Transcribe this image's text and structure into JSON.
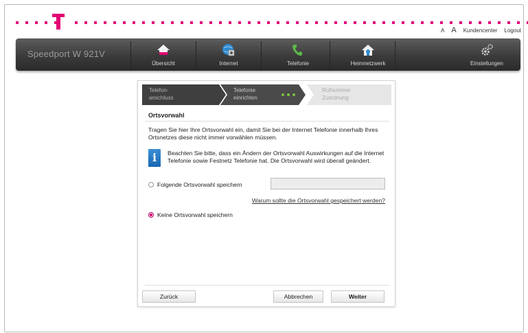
{
  "header": {
    "font_small_label": "A",
    "font_large_label": "A",
    "kundencenter_label": "Kundencenter",
    "logout_label": "Logout",
    "brand_color": "#e20074"
  },
  "navbar": {
    "title": "Speedport W 921V",
    "items": [
      {
        "label": "Übersicht",
        "icon": "home-icon"
      },
      {
        "label": "Internet",
        "icon": "globe-icon"
      },
      {
        "label": "Telefonie",
        "icon": "phone-icon"
      },
      {
        "label": "Heimnetzwerk",
        "icon": "home-network-icon"
      },
      {
        "label": "Einstellungen",
        "icon": "gears-icon"
      }
    ]
  },
  "wizard": {
    "steps": [
      {
        "line1": "Telefon-",
        "line2": "anschluss",
        "state": "done"
      },
      {
        "line1": "Telefonie",
        "line2": "einrichten",
        "state": "active"
      },
      {
        "line1": "Rufnummer",
        "line2": "Zuordnung",
        "state": "pending"
      }
    ],
    "section_title": "Ortsvorwahl",
    "intro": "Tragen Sie hier Ihre Ortsvorwahl ein, damit Sie bei der Internet Telefonie innerhalb Ihres Ortsnetzes diese nicht immer vorwählen müssen.",
    "info": "Beachten Sie bitte, dass ein Ändern der Ortsvorwahl Auswirkungen auf die Internet Telefonie sowie Festnetz Telefonie hat. Die Ortsvorwahl wird überall geändert.",
    "option_save_label": "Folgende Ortsvorwahl speichern",
    "option_save_value": "",
    "help_link": "Warum sollte die Ortsvorwahl gespeichert werden?",
    "option_none_label": "Keine Ortsvorwahl speichern",
    "selected_option": "none",
    "back_label": "Zurück",
    "cancel_label": "Abbrechen",
    "next_label": "Weiter"
  }
}
